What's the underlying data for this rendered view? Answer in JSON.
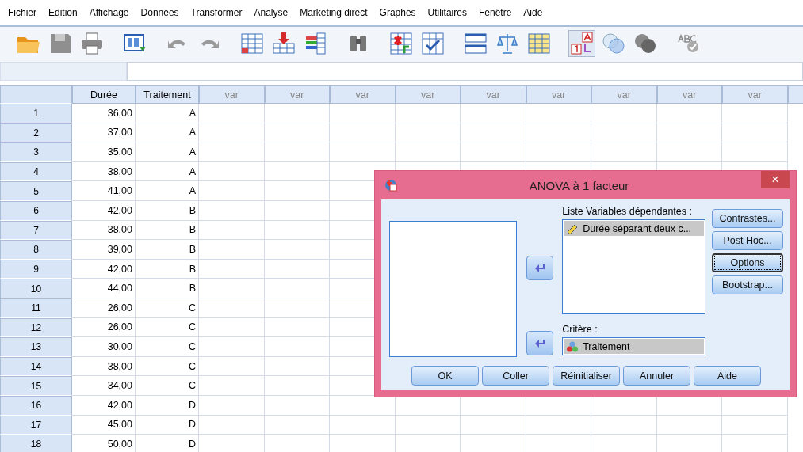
{
  "menu": [
    "Fichier",
    "Edition",
    "Affichage",
    "Données",
    "Transformer",
    "Analyse",
    "Marketing direct",
    "Graphes",
    "Utilitaires",
    "Fenêtre",
    "Aide"
  ],
  "grid": {
    "columns": [
      {
        "label": "Durée",
        "kind": "variable"
      },
      {
        "label": "Traitement",
        "kind": "variable"
      },
      {
        "label": "var",
        "kind": "empty"
      },
      {
        "label": "var",
        "kind": "empty"
      },
      {
        "label": "var",
        "kind": "empty"
      },
      {
        "label": "var",
        "kind": "empty"
      },
      {
        "label": "var",
        "kind": "empty"
      },
      {
        "label": "var",
        "kind": "empty"
      },
      {
        "label": "var",
        "kind": "empty"
      },
      {
        "label": "var",
        "kind": "empty"
      },
      {
        "label": "var",
        "kind": "empty"
      }
    ],
    "rows": [
      {
        "number": "1",
        "cells": [
          "36,00",
          "A"
        ]
      },
      {
        "number": "2",
        "cells": [
          "37,00",
          "A"
        ]
      },
      {
        "number": "3",
        "cells": [
          "35,00",
          "A"
        ]
      },
      {
        "number": "4",
        "cells": [
          "38,00",
          "A"
        ]
      },
      {
        "number": "5",
        "cells": [
          "41,00",
          "A"
        ]
      },
      {
        "number": "6",
        "cells": [
          "42,00",
          "B"
        ]
      },
      {
        "number": "7",
        "cells": [
          "38,00",
          "B"
        ]
      },
      {
        "number": "8",
        "cells": [
          "39,00",
          "B"
        ]
      },
      {
        "number": "9",
        "cells": [
          "42,00",
          "B"
        ]
      },
      {
        "number": "10",
        "cells": [
          "44,00",
          "B"
        ]
      },
      {
        "number": "11",
        "cells": [
          "26,00",
          "C"
        ]
      },
      {
        "number": "12",
        "cells": [
          "26,00",
          "C"
        ]
      },
      {
        "number": "13",
        "cells": [
          "30,00",
          "C"
        ]
      },
      {
        "number": "14",
        "cells": [
          "38,00",
          "C"
        ]
      },
      {
        "number": "15",
        "cells": [
          "34,00",
          "C"
        ]
      },
      {
        "number": "16",
        "cells": [
          "42,00",
          "D"
        ]
      },
      {
        "number": "17",
        "cells": [
          "45,00",
          "D"
        ]
      },
      {
        "number": "18",
        "cells": [
          "50,00",
          "D"
        ]
      }
    ]
  },
  "dialog": {
    "title": "ANOVA à 1 facteur",
    "close": "×",
    "dependent_label": "Liste Variables dépendantes :",
    "dependent_items": [
      {
        "label": "Durée séparant deux c...",
        "kind": "scale"
      }
    ],
    "factor_label": "Critère :",
    "factor_item": {
      "label": "Traitement",
      "kind": "nominal"
    },
    "side_buttons": [
      {
        "label": "Contrastes...",
        "focused": false
      },
      {
        "label": "Post Hoc...",
        "focused": false
      },
      {
        "label": "Options",
        "focused": true
      },
      {
        "label": "Bootstrap...",
        "focused": false
      }
    ],
    "buttons": [
      "OK",
      "Coller",
      "Réinitialiser",
      "Annuler",
      "Aide"
    ]
  }
}
